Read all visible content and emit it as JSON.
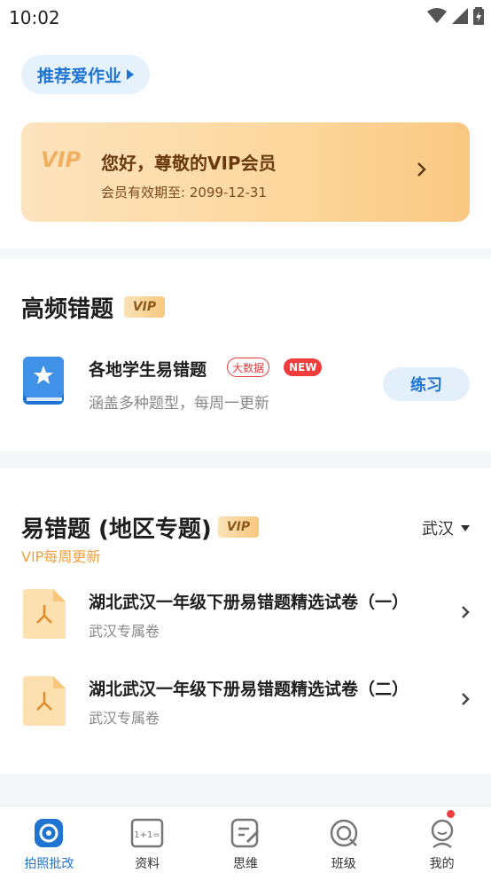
{
  "status_bar": {
    "time": "10:02"
  },
  "recommend_button": {
    "label": "推荐爱作业"
  },
  "vip_card": {
    "logo_text": "VIP",
    "title": "您好，尊敬的VIP会员",
    "expiry": "会员有效期至: 2099-12-31"
  },
  "high_freq": {
    "title": "高频错题",
    "badge": "VIP",
    "item": {
      "title": "各地学生易错题",
      "tag_bigdata": "大数据",
      "tag_new": "NEW",
      "subtitle": "涵盖多种题型，每周一更新",
      "action": "练习"
    }
  },
  "regional": {
    "title": "易错题 (地区专题)",
    "badge": "VIP",
    "subtitle": "VIP每周更新",
    "region": "武汉",
    "papers": [
      {
        "title": "湖北武汉一年级下册易错题精选试卷（一）",
        "subtitle": "武汉专属卷"
      },
      {
        "title": "湖北武汉一年级下册易错题精选试卷（二）",
        "subtitle": "武汉专属卷"
      }
    ]
  },
  "tabs": [
    {
      "label": "拍照批改",
      "icon": "camera-check-icon",
      "active": true
    },
    {
      "label": "资料",
      "icon": "materials-icon",
      "active": false
    },
    {
      "label": "思维",
      "icon": "thinking-icon",
      "active": false
    },
    {
      "label": "班级",
      "icon": "class-icon",
      "active": false
    },
    {
      "label": "我的",
      "icon": "profile-icon",
      "active": false
    }
  ],
  "tab_badge_icon_value": "1+1=",
  "colors": {
    "accent": "#1f74d1",
    "vip_gold": "#f0a040",
    "alert_red": "#f03c3c"
  }
}
